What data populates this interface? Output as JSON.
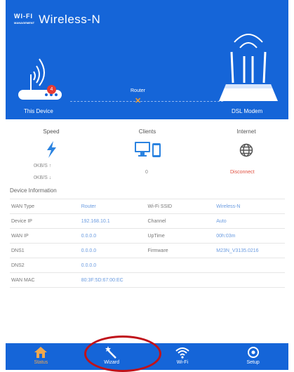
{
  "header": {
    "logo_mark": "WI-FI",
    "logo_sub": "MANAGEMENT",
    "app_name": "Wireless-N",
    "this_device_label": "This Device",
    "router_label": "Router",
    "dsl_modem_label": "DSL Modem",
    "badge_count": "4"
  },
  "stats": {
    "speed": {
      "title": "Speed",
      "up": "0KB/S ↑",
      "down": "0KB/S ↓"
    },
    "clients": {
      "title": "Clients",
      "count": "0"
    },
    "internet": {
      "title": "Internet",
      "status": "Disconnect"
    }
  },
  "device_info": {
    "title": "Device Information",
    "rows": [
      {
        "label": "WAN Type",
        "value": "Router",
        "label2": "Wi-Fi SSID",
        "value2": "Wireless-N"
      },
      {
        "label": "Device IP",
        "value": "192.168.10.1",
        "label2": "Channel",
        "value2": "Auto"
      },
      {
        "label": "WAN IP",
        "value": "0.0.0.0",
        "label2": "UpTime",
        "value2": "00h:03m"
      },
      {
        "label": "DNS1",
        "value": "0.0.0.0",
        "label2": "Firmware",
        "value2": "M23N_V3135.0216"
      },
      {
        "label": "DNS2",
        "value": "0.0.0.0",
        "label2": "",
        "value2": ""
      },
      {
        "label": "WAN MAC",
        "value": "80:3F:5D:67:00:EC",
        "label2": "",
        "value2": ""
      }
    ]
  },
  "tabs": [
    {
      "label": "Status",
      "icon": "home-icon",
      "active": true
    },
    {
      "label": "Wizard",
      "icon": "wizard-wand-icon",
      "active": false
    },
    {
      "label": "Wi-Fi",
      "icon": "wifi-icon",
      "active": false
    },
    {
      "label": "Setup",
      "icon": "gear-icon",
      "active": false
    }
  ],
  "colors": {
    "brand": "#1565d8",
    "accent": "#f0a84e",
    "alert": "#e53a34",
    "value": "#6a9be0"
  }
}
